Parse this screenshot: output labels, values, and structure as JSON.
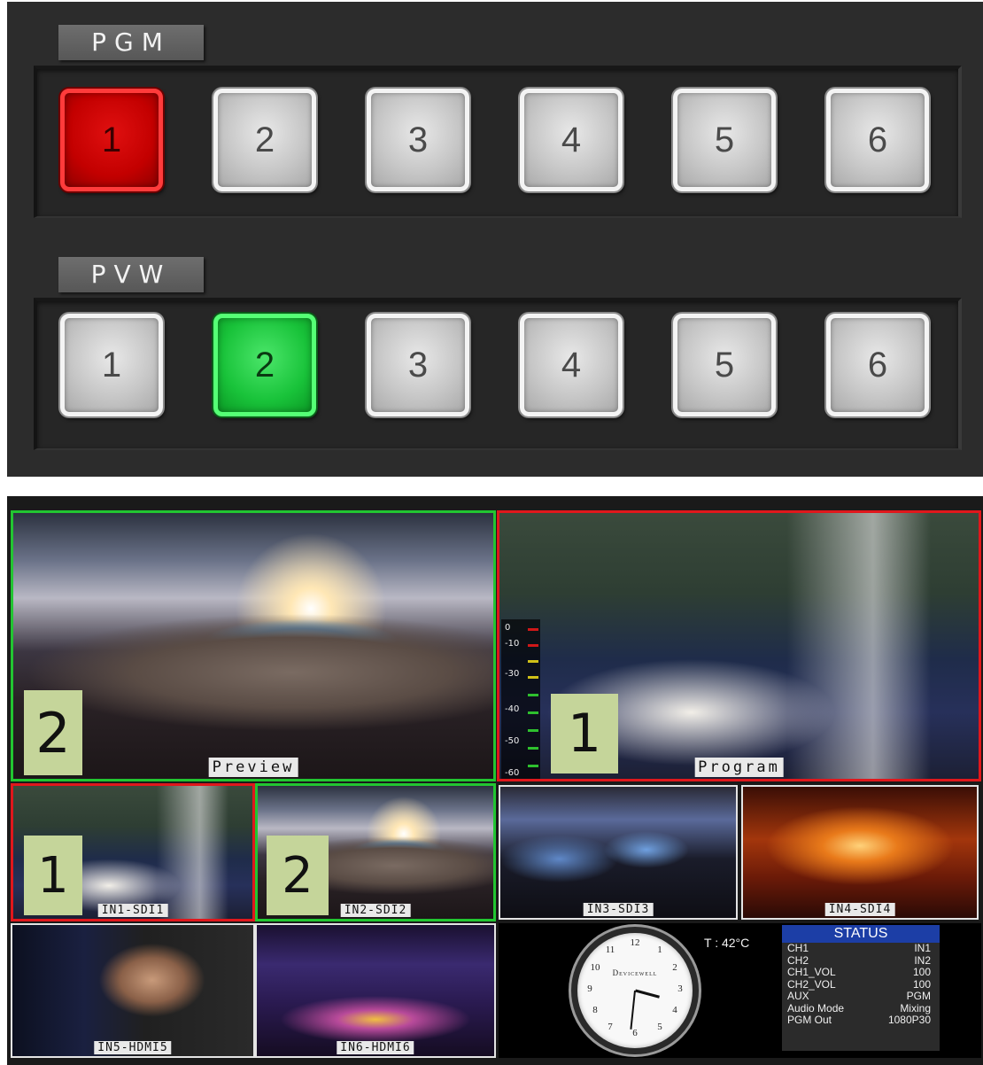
{
  "colors": {
    "pgm_active": "#c30000",
    "pvw_active": "#19c33a",
    "program_border": "#e0171c",
    "preview_border": "#22c531",
    "status_header": "#1c3ea6"
  },
  "pgm_bus": {
    "label": "PGM",
    "active": "1",
    "buttons": [
      "1",
      "2",
      "3",
      "4",
      "5",
      "6"
    ]
  },
  "pvw_bus": {
    "label": "PVW",
    "active": "2",
    "buttons": [
      "1",
      "2",
      "3",
      "4",
      "5",
      "6"
    ]
  },
  "multiview": {
    "preview": {
      "caption": "Preview",
      "tally": "2"
    },
    "program": {
      "caption": "Program",
      "tally": "1"
    },
    "inputs": [
      {
        "caption": "IN1-SDI1",
        "tally": "1"
      },
      {
        "caption": "IN2-SDI2",
        "tally": "2"
      },
      {
        "caption": "IN3-SDI3"
      },
      {
        "caption": "IN4-SDI4"
      },
      {
        "caption": "IN5-HDMI5"
      },
      {
        "caption": "IN6-HDMI6"
      }
    ],
    "audio_meter": {
      "labels": [
        "0",
        "-10",
        "-30",
        "-40",
        "-50",
        "-60"
      ]
    },
    "clock": {
      "brand": "Devicewell",
      "numbers": [
        "12",
        "1",
        "2",
        "3",
        "4",
        "5",
        "6",
        "7",
        "8",
        "9",
        "10",
        "11"
      ],
      "time": "3:31"
    },
    "temperature": "T : 42°C",
    "status": {
      "title": "STATUS",
      "rows": [
        {
          "key": "CH1",
          "value": "IN1"
        },
        {
          "key": "CH2",
          "value": "IN2"
        },
        {
          "key": "CH1_VOL",
          "value": "100"
        },
        {
          "key": "CH2_VOL",
          "value": "100"
        },
        {
          "key": "AUX",
          "value": "PGM"
        },
        {
          "key": "Audio Mode",
          "value": "Mixing"
        },
        {
          "key": "PGM Out",
          "value": "1080P30"
        }
      ]
    }
  }
}
